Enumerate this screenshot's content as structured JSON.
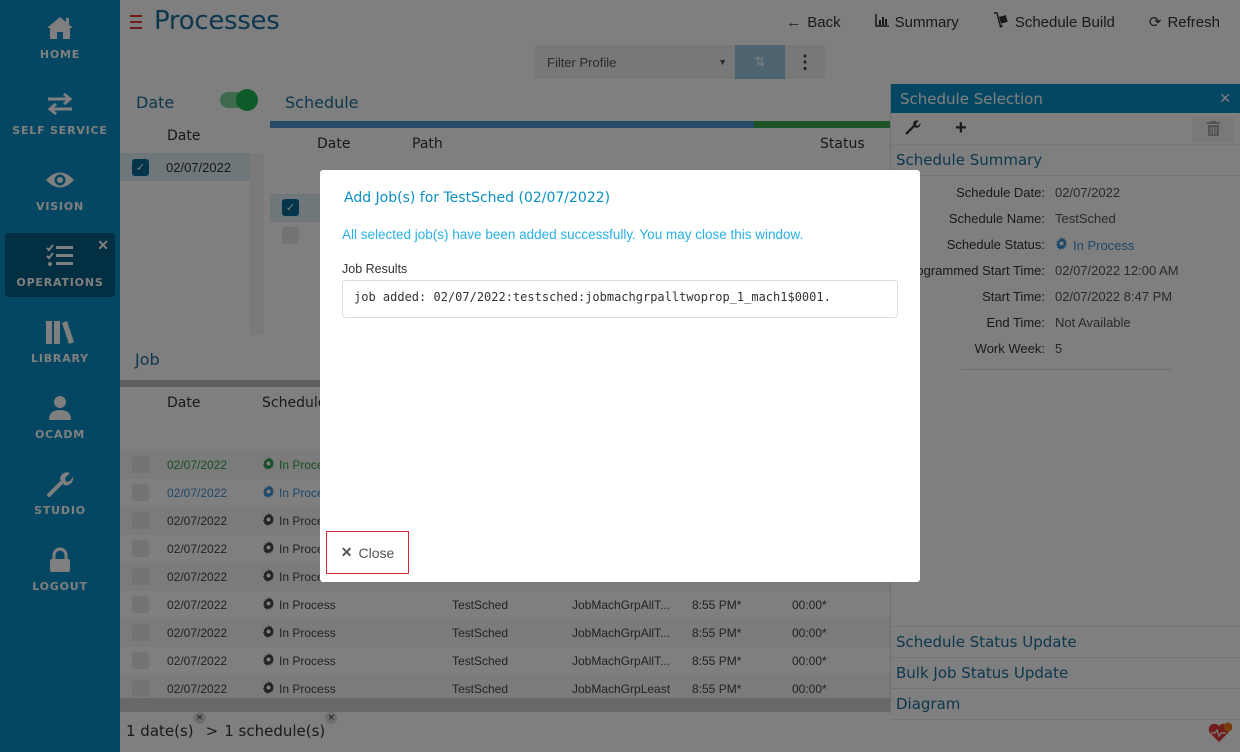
{
  "sidebar": {
    "items": [
      {
        "label": "HOME",
        "icon": "home-icon"
      },
      {
        "label": "SELF SERVICE",
        "icon": "swap-arrows-icon"
      },
      {
        "label": "VISION",
        "icon": "eye-icon"
      },
      {
        "label": "OPERATIONS",
        "icon": "checklist-icon",
        "active": true
      },
      {
        "label": "LIBRARY",
        "icon": "books-icon"
      },
      {
        "label": "OCADM",
        "icon": "user-icon"
      },
      {
        "label": "STUDIO",
        "icon": "wrench-icon"
      },
      {
        "label": "LOGOUT",
        "icon": "lock-icon"
      }
    ],
    "close_glyph": "✕"
  },
  "header": {
    "title": "Processes",
    "toolbar": {
      "back": "Back",
      "summary": "Summary",
      "schedule_build": "Schedule Build",
      "refresh": "Refresh"
    },
    "filter": {
      "placeholder": "Filter Profile",
      "more_glyph": "⋮"
    }
  },
  "date_panel": {
    "title": "Date",
    "toggle_on": true,
    "column": "Date",
    "rows": [
      {
        "date": "02/07/2022",
        "checked": true
      }
    ]
  },
  "schedule_panel": {
    "title": "Schedule",
    "progress_fraction": 0.78,
    "columns": [
      "Date",
      "Path",
      "Status"
    ]
  },
  "job_panel": {
    "title": "Job",
    "columns": [
      "Date",
      "Schedule S"
    ],
    "rows": [
      {
        "date": "02/07/2022",
        "status": "In Process",
        "schedule": "",
        "job": "",
        "time": "",
        "dur": "",
        "color": "#2e9e4f"
      },
      {
        "date": "02/07/2022",
        "status": "In Process",
        "schedule": "",
        "job": "",
        "time": "",
        "dur": "",
        "color": "#3f8fd0"
      },
      {
        "date": "02/07/2022",
        "status": "In Process",
        "schedule": "",
        "job": "",
        "time": "",
        "dur": "",
        "color": "#444444"
      },
      {
        "date": "02/07/2022",
        "status": "In Process",
        "schedule": "",
        "job": "",
        "time": "",
        "dur": "",
        "color": "#444444"
      },
      {
        "date": "02/07/2022",
        "status": "In Process",
        "schedule": "",
        "job": "",
        "time": "",
        "dur": "",
        "color": "#444444"
      },
      {
        "date": "02/07/2022",
        "status": "In Process",
        "schedule": "TestSched",
        "job": "JobMachGrpAllT...",
        "time": "8:55 PM*",
        "dur": "00:00*",
        "color": "#444444"
      },
      {
        "date": "02/07/2022",
        "status": "In Process",
        "schedule": "TestSched",
        "job": "JobMachGrpAllT...",
        "time": "8:55 PM*",
        "dur": "00:00*",
        "color": "#444444"
      },
      {
        "date": "02/07/2022",
        "status": "In Process",
        "schedule": "TestSched",
        "job": "JobMachGrpAllT...",
        "time": "8:55 PM*",
        "dur": "00:00*",
        "color": "#444444"
      },
      {
        "date": "02/07/2022",
        "status": "In Process",
        "schedule": "TestSched",
        "job": "JobMachGrpLeast",
        "time": "8:55 PM*",
        "dur": "00:00*",
        "color": "#444444"
      }
    ]
  },
  "breadcrumb": {
    "dates": "1 date(s)",
    "separator": ">",
    "schedules": "1 schedule(s)",
    "remove_glyph": "×"
  },
  "right_panel": {
    "title": "Schedule Selection",
    "section": "Schedule Summary",
    "summary": [
      {
        "label": "Schedule Date:",
        "value": "02/07/2022"
      },
      {
        "label": "Schedule Name:",
        "value": "TestSched"
      },
      {
        "label": "Schedule Status:",
        "value": "In Process"
      },
      {
        "label": "Programmed Start Time:",
        "value": "02/07/2022 12:00 AM"
      },
      {
        "label": "Start Time:",
        "value": "02/07/2022 8:47 PM"
      },
      {
        "label": "End Time:",
        "value": "Not Available"
      },
      {
        "label": "Work Week:",
        "value": "5"
      }
    ],
    "bottom_sections": [
      "Schedule Status Update",
      "Bulk Job Status Update",
      "Diagram"
    ]
  },
  "modal": {
    "title": "Add Job(s) for TestSched (02/07/2022)",
    "message": "All selected job(s) have been added successfully. You may close this window.",
    "results_label": "Job Results",
    "result_text": "job added: 02/07/2022:testsched:jobmachgrpalltwoprop_1_mach1$0001.",
    "close_label": "Close"
  },
  "colors": {
    "sidebar": "#0a8fc4",
    "accent": "#1b6f9a",
    "success_text": "#29b0e4",
    "close_border": "#d9262f",
    "toggle": "#1fb954"
  }
}
